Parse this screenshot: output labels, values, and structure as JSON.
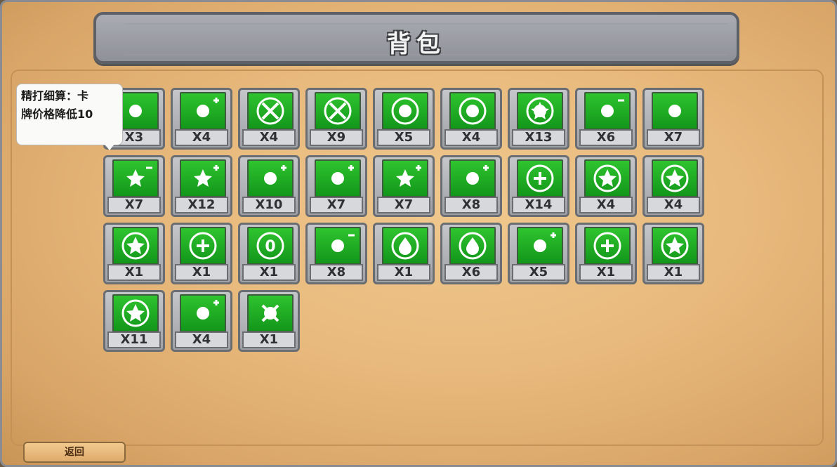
{
  "title": "背包",
  "tooltip": {
    "line1": "精打细算：卡",
    "line2": "牌价格降低10"
  },
  "back_label": "返回",
  "colors": {
    "slot_icon_green": "#1aa81f",
    "parchment": "#e8b97c",
    "stone": "#9ea1a6"
  },
  "items": [
    {
      "icon": "eye-icon",
      "qty": "X3"
    },
    {
      "icon": "egg-plus-icon",
      "qty": "X4"
    },
    {
      "icon": "target-ring-icon",
      "qty": "X4"
    },
    {
      "icon": "cross-target-icon",
      "qty": "X9"
    },
    {
      "icon": "creature-swirl-icon",
      "qty": "X5"
    },
    {
      "icon": "face-ring-icon",
      "qty": "X4"
    },
    {
      "icon": "face-crown-icon",
      "qty": "X13"
    },
    {
      "icon": "hand-minus-icon",
      "qty": "X6"
    },
    {
      "icon": "cards-icon",
      "qty": "X7"
    },
    {
      "icon": "burst-minus-icon",
      "qty": "X7"
    },
    {
      "icon": "burst-plus-icon",
      "qty": "X12"
    },
    {
      "icon": "bomb-plus-icon",
      "qty": "X10"
    },
    {
      "icon": "fist-plus-icon",
      "qty": "X7"
    },
    {
      "icon": "hedgehog-plus-icon",
      "qty": "X7"
    },
    {
      "icon": "apple-plus-icon",
      "qty": "X8"
    },
    {
      "icon": "heal-ring-icon",
      "qty": "X14"
    },
    {
      "icon": "fan-ring-icon",
      "qty": "X4"
    },
    {
      "icon": "fang-ring-icon",
      "qty": "X4"
    },
    {
      "icon": "fang-ring-icon",
      "qty": "X1"
    },
    {
      "icon": "plus-ring-icon",
      "qty": "X1"
    },
    {
      "icon": "zero-ring-icon",
      "qty": "X1"
    },
    {
      "icon": "hammer-minus-icon",
      "qty": "X8"
    },
    {
      "icon": "drop-ring-icon",
      "qty": "X1"
    },
    {
      "icon": "fang-drop-icon",
      "qty": "X6"
    },
    {
      "icon": "eggs-plus-icon",
      "qty": "X5"
    },
    {
      "icon": "plus-wave-icon",
      "qty": "X1"
    },
    {
      "icon": "fang-ring-icon",
      "qty": "X1"
    },
    {
      "icon": "burst-ring-icon",
      "qty": "X11"
    },
    {
      "icon": "apple-plus-icon",
      "qty": "X4"
    },
    {
      "icon": "tools-icon",
      "qty": "X1"
    }
  ]
}
